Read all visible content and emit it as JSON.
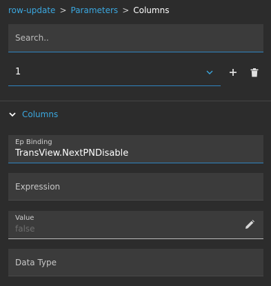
{
  "breadcrumb": {
    "items": [
      "row-update",
      "Parameters"
    ],
    "separator": ">",
    "current": "Columns"
  },
  "search": {
    "placeholder": "Search.."
  },
  "selector": {
    "value": "1"
  },
  "section": {
    "title": "Columns"
  },
  "fields": {
    "ep_binding": {
      "label": "Ep Binding",
      "value": "TransView.NextPNDisable"
    },
    "expression": {
      "placeholder": "Expression"
    },
    "value": {
      "label": "Value",
      "value": "false"
    },
    "data_type": {
      "placeholder": "Data Type"
    }
  },
  "icons": {
    "chevron": "chevron-down-icon",
    "add": "plus-icon",
    "delete": "trash-icon",
    "collapse": "chevron-down-icon",
    "edit": "pencil-icon"
  },
  "colors": {
    "background": "#2c2c2c",
    "field": "#3b3b3b",
    "accent": "#3ba8e0",
    "focus_line": "#2f86c4"
  }
}
